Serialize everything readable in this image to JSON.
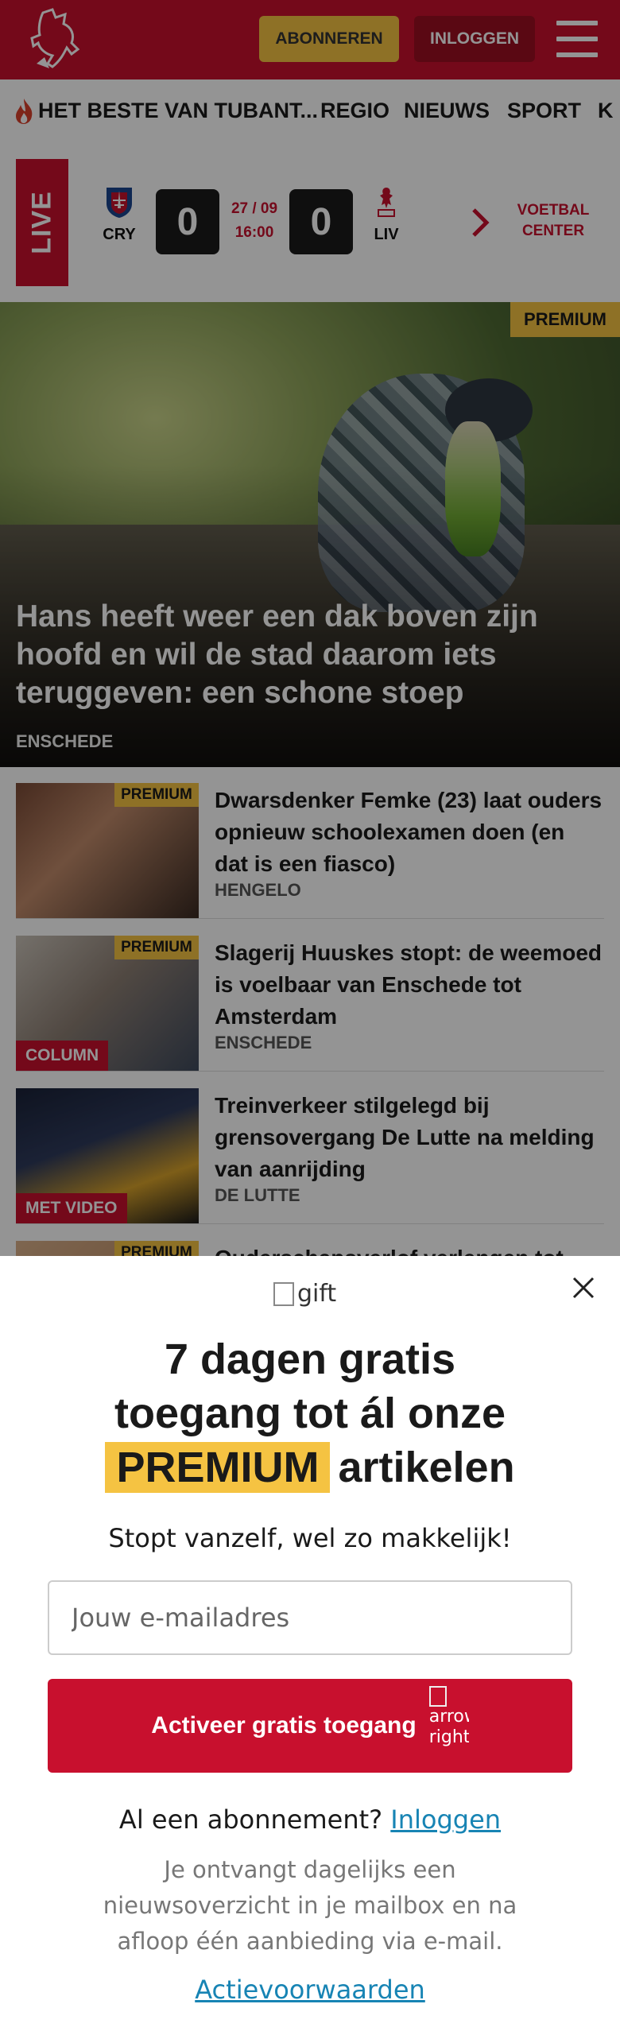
{
  "header": {
    "subscribe_label": "ABONNEREN",
    "login_label": "INLOGGEN",
    "logo_icon": "horse-logo-icon",
    "menu_icon": "hamburger-icon",
    "brand_color": "#c8102e",
    "accent_color": "#f5c342"
  },
  "nav": {
    "items": [
      "HET BESTE VAN TUBANT...",
      "REGIO",
      "NIEUWS",
      "SPORT",
      "K"
    ]
  },
  "live": {
    "label": "LIVE",
    "home_abbr": "CRY",
    "home_score": "0",
    "date": "27 / 09",
    "time": "16:00",
    "away_score": "0",
    "away_abbr": "LIV",
    "center_line1": "VOETBAL",
    "center_line2": "CENTER"
  },
  "hero": {
    "badge": "PREMIUM",
    "title": "Hans heeft weer een dak boven zijn hoofd en wil de stad daarom iets teruggeven: een schone stoep",
    "location": "ENSCHEDE"
  },
  "articles": [
    {
      "title": "Dwarsdenker Femke (23) laat ouders opnieuw schoolexamen doen (en dat is een fiasco)",
      "location": "HENGELO",
      "badge": "PREMIUM",
      "label": ""
    },
    {
      "title": "Slagerij Huuskes stopt: de weemoed is voelbaar van Enschede tot Amsterdam",
      "location": "ENSCHEDE",
      "badge": "PREMIUM",
      "label": "COLUMN"
    },
    {
      "title": "Treinverkeer stilgelegd bij grensovergang De Lutte na melding van aanrijding",
      "location": "DE LUTTE",
      "badge": "",
      "label": "MET VIDEO"
    },
    {
      "title": "Ouderschapsverlof verlengen tot",
      "location": "",
      "badge": "PREMIUM",
      "label": ""
    }
  ],
  "modal": {
    "gift_alt": "gift",
    "headline_line1": "7 dagen gratis",
    "headline_line2": "toegang tot ál onze",
    "headline_badge": "PREMIUM",
    "headline_line3": "artikelen",
    "subline": "Stopt vanzelf, wel zo makkelijk!",
    "email_placeholder": "Jouw e-mailadres",
    "cta_label": "Activeer gratis toegang",
    "cta_arrow_alt": "arrow right",
    "already_text": "Al een abonnement?",
    "already_link": "Inloggen",
    "disclaimer": "Je ontvangt dagelijks een nieuwsoverzicht in je mailbox en na afloop één aanbieding via e-mail.",
    "terms_link": "Actievoorwaarden"
  }
}
